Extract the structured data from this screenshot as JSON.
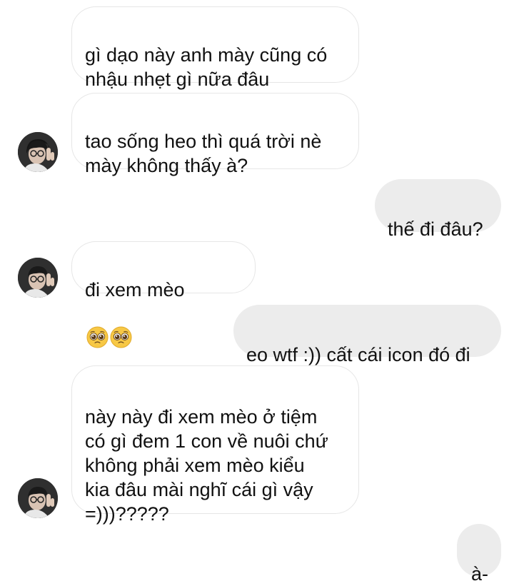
{
  "conversation": {
    "messages": [
      {
        "id": "m1",
        "sender": "them",
        "text": "gì dạo này anh mày cũng có\nnhậu nhẹt gì nữa đâu"
      },
      {
        "id": "m2",
        "sender": "them",
        "text": "tao sống heo thì quá trời nè\nmày không thấy à?"
      },
      {
        "id": "m3",
        "sender": "me",
        "text": "thế đi đâu?"
      },
      {
        "id": "m4",
        "sender": "them",
        "text": "đi xem mèo",
        "emoji": [
          "pleading-face-emoji",
          "pleading-face-emoji"
        ]
      },
      {
        "id": "m5",
        "sender": "me",
        "text": "eo wtf :)) cất cái icon đó đi"
      },
      {
        "id": "m6",
        "sender": "them",
        "text": "này này đi xem mèo ở tiệm\ncó gì đem 1 con về nuôi chứ\nkhông phải xem mèo kiểu\nkia đâu mài nghĩ cái gì vậy\n=)))?????"
      },
      {
        "id": "m7",
        "sender": "me",
        "text": "à-"
      }
    ]
  },
  "colors": {
    "incoming_bubble": "#ffffff",
    "incoming_border": "#e6e6e6",
    "outgoing_bubble": "#ececec",
    "text": "#111111"
  }
}
